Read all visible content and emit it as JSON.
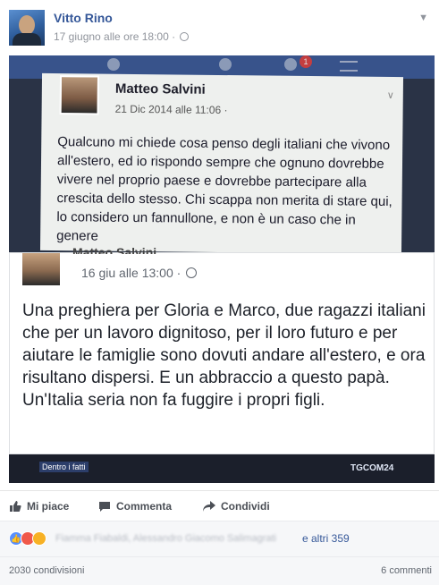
{
  "post": {
    "author": "Vitto Rino",
    "timestamp": "17 giugno alle ore 18:00 ·",
    "privacy_icon": "globe-icon"
  },
  "photo": {
    "screenshot_old": {
      "author": "Matteo Salvini",
      "date": "21 Dic 2014 alle 11:06 ·",
      "text": "Qualcuno mi chiede cosa penso degli italiani che vivono all'estero, ed io rispondo sempre che ognuno dovrebbe vivere nel proprio paese e dovrebbe partecipare alla crescita dello stesso. Chi scappa non merita di stare qui, lo considero un fannullone, e non è un caso che in genere",
      "notification_count": "1"
    },
    "screenshot_new": {
      "author_cut": "Matteo Salvini",
      "date": "16 giu alle 13:00 ·",
      "text": "Una preghiera per Gloria e Marco, due ragazzi italiani che per un lavoro dignitoso, per il loro futuro e per aiutare le famiglie sono dovuti andare all'estero, e ora risultano dispersi. E un abbraccio a questo papà. Un'Italia seria non fa fuggire i propri figli."
    },
    "tv_labels": {
      "left": "Dentro i fatti",
      "right": "TGCOM24"
    }
  },
  "actions": {
    "like": "Mi piace",
    "comment": "Commenta",
    "share": "Condividi"
  },
  "reactions": {
    "names_blurred": "Fiamma Fiabaldi, Alessandro Giacomo Salimagrati",
    "others": "e altri 359"
  },
  "footer": {
    "shares": "2030 condivisioni",
    "comments": "6 commenti"
  },
  "colors": {
    "link": "#365899",
    "meta": "#90949c",
    "facebook_blue": "#3b5998"
  }
}
